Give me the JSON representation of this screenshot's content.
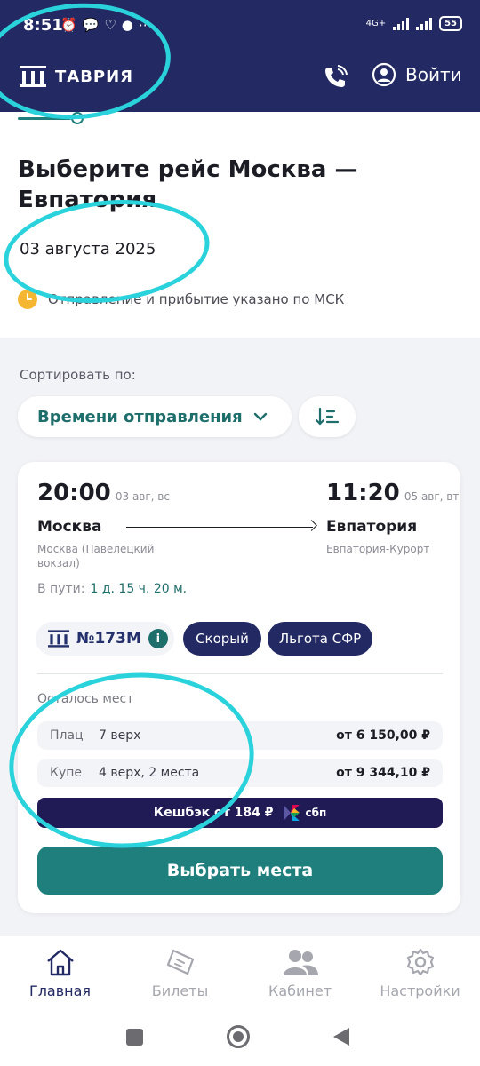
{
  "status_bar": {
    "time": "8:51",
    "icons": [
      "alarm-icon",
      "chat-icon",
      "heart-icon",
      "more-icon"
    ],
    "network": "4G+",
    "battery": "55"
  },
  "header": {
    "logo_text": "ТАВРИЯ",
    "login_label": "Войти"
  },
  "title": {
    "heading": "Выберите рейс Москва — Евпатория",
    "date": "03 августа 2025",
    "note": "Отправление и прибытие указано по МСК"
  },
  "sort": {
    "label": "Сортировать по:",
    "selected": "Времени отправления"
  },
  "trip": {
    "depart_time": "20:00",
    "depart_date": "03 авг, вс",
    "arrive_time": "11:20",
    "arrive_date": "05 авг, вт",
    "from_city": "Москва",
    "from_station": "Москва (Павелецкий вокзал)",
    "to_city": "Евпатория",
    "to_station": "Евпатория-Курорт",
    "travel_label": "В пути:",
    "travel_time": "1 д. 15 ч. 20 м.",
    "train_number": "№173М",
    "tags": [
      "Скорый",
      "Льгота СФР"
    ],
    "seats_label": "Осталось мест",
    "seats": [
      {
        "class": "Плац",
        "available": "7 верх",
        "price": "от 6 150,00 ₽"
      },
      {
        "class": "Купе",
        "available": "4 верх, 2 места",
        "price": "от 9 344,10 ₽"
      }
    ],
    "cashback": "Кешбэк от 184 ₽",
    "sbp": "сбп",
    "select_button": "Выбрать места"
  },
  "bottom_nav": [
    {
      "label": "Главная",
      "icon": "home-icon",
      "active": true
    },
    {
      "label": "Билеты",
      "icon": "ticket-icon",
      "active": false
    },
    {
      "label": "Кабинет",
      "icon": "users-icon",
      "active": false
    },
    {
      "label": "Настройки",
      "icon": "gear-icon",
      "active": false
    }
  ],
  "colors": {
    "header": "#232a63",
    "accent": "#1e7f7d",
    "marker": "#2ad2dc"
  }
}
